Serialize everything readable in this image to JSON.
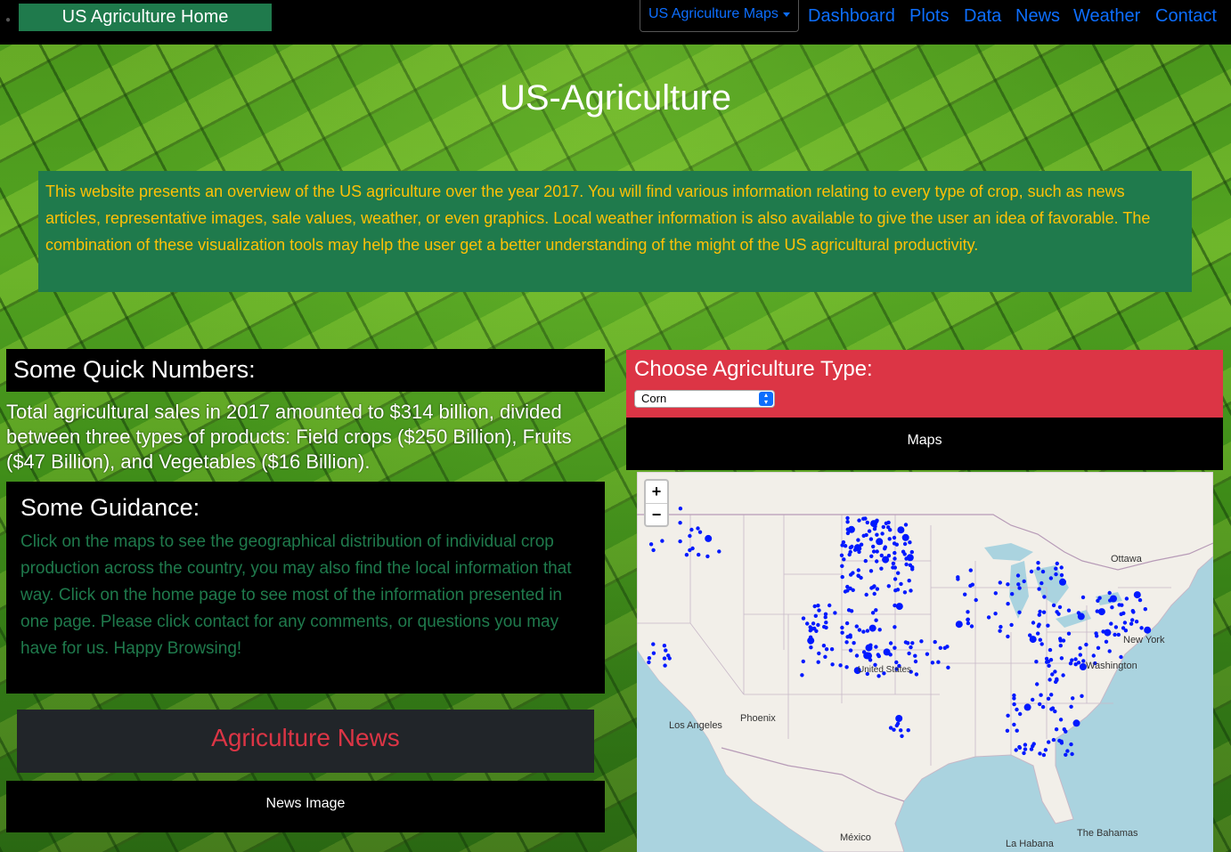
{
  "navbar": {
    "brand": "US Agriculture Home",
    "dropdown_label": "US Agriculture Maps",
    "links": [
      "Dashboard",
      "Plots",
      "Data",
      "News",
      "Weather",
      "Contact"
    ]
  },
  "hero": {
    "title": "US-Agriculture",
    "intro": "This website presents an overview of the US agriculture over the year 2017. You will find various information relating to every type of crop, such as news articles, representative images, sale values, weather, or even graphics. Local weather information is also available to give the user an idea of favorable. The combination of these visualization tools may help the user get a better understanding of the might of the US agricultural productivity."
  },
  "quick": {
    "heading": "Some Quick Numbers:",
    "text": "Total agricultural sales in 2017 amounted to $314 billion, divided between three types of products: Field crops ($250 Billion), Fruits ($47 Billion), and Vegetables ($16 Billion)."
  },
  "guidance": {
    "heading": "Some Guidance:",
    "text": "Click on the maps to see the geographical distribution of individual crop production across the country, you may also find the local information that way. Click on the home page to see most of the information presented in one page. Please click contact for any comments, or questions you may have for us. Happy Browsing!"
  },
  "news": {
    "heading": "Agriculture News",
    "image_caption": "News Image"
  },
  "chooser": {
    "heading": "Choose Agriculture Type:",
    "selected": "Corn"
  },
  "maps": {
    "label": "Maps",
    "zoom_in": "+",
    "zoom_out": "−",
    "places": {
      "ottawa": "Ottawa",
      "new_york": "New York",
      "washington": "Washington",
      "united_states": "United States",
      "los_angeles": "Los Angeles",
      "phoenix": "Phoenix",
      "mexico": "México",
      "la_habana": "La Habana",
      "bahamas": "The Bahamas"
    }
  },
  "colors": {
    "brand_green": "#1f7a4c",
    "intro_text": "#ffc107",
    "nav_link": "#0d6efd",
    "chooser_bg": "#dc3545",
    "news_title": "#dc3545",
    "marker": "#0019ff"
  }
}
